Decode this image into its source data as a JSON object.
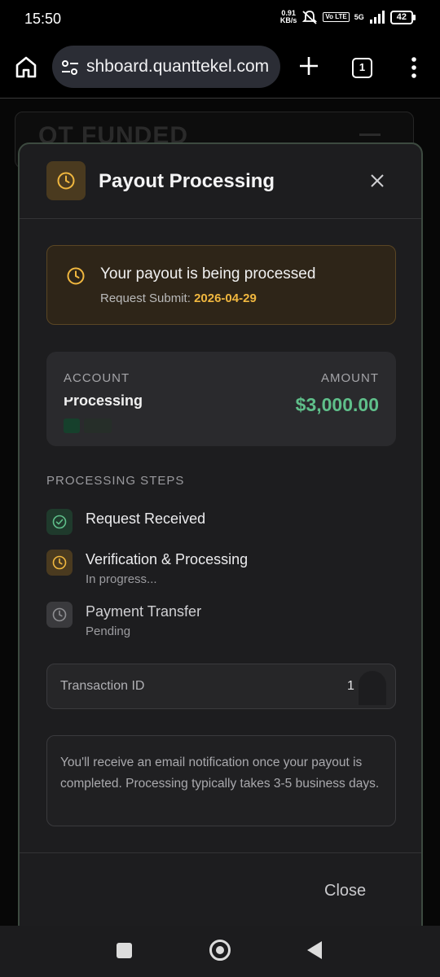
{
  "status_bar": {
    "time": "15:50",
    "net_speed_value": "0.91",
    "net_speed_unit": "KB/s",
    "volte_badge": "Vo LTE",
    "network": "5G",
    "battery": "42"
  },
  "browser": {
    "url": "shboard.quanttekel.com",
    "tab_count": "1"
  },
  "background_page": {
    "logo_text": "QT FUNDED"
  },
  "modal": {
    "title": "Payout Processing",
    "alert": {
      "title": "Your payout is being processed",
      "sub_label": "Request Submit: ",
      "date": "2026-04-29"
    },
    "account": {
      "account_label": "ACCOUNT",
      "account_name": "Processing",
      "amount_label": "AMOUNT",
      "amount_value": "$3,000.00"
    },
    "steps_title": "PROCESSING STEPS",
    "steps": [
      {
        "label": "Request Received",
        "sub": "",
        "state": "done"
      },
      {
        "label": "Verification & Processing",
        "sub": "In progress...",
        "state": "active"
      },
      {
        "label": "Payment Transfer",
        "sub": "Pending",
        "state": "pending"
      }
    ],
    "transaction": {
      "label": "Transaction ID",
      "value": "1"
    },
    "info_text": "You'll receive an email notification once your payout is completed. Processing typically takes 3-5 business days.",
    "close_label": "Close"
  },
  "colors": {
    "accent_amber": "#f0b73f",
    "success_green": "#5fbf8a",
    "modal_bg": "#1d1d1f"
  }
}
